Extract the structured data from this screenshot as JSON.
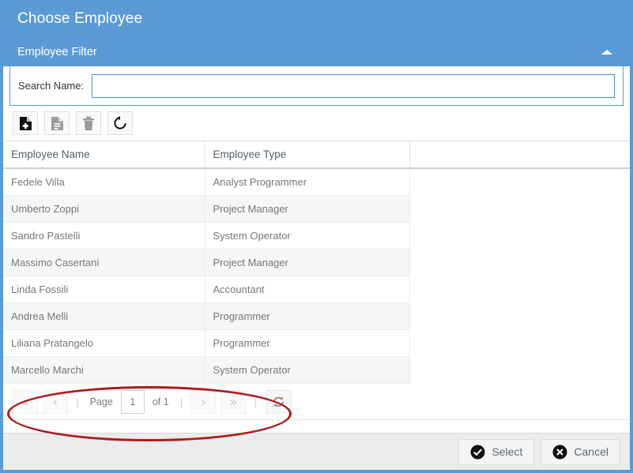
{
  "dialog": {
    "title": "Choose Employee",
    "filter_section_label": "Employee Filter",
    "collapse_icon": "chevron-up-icon"
  },
  "filter": {
    "search_label": "Search Name:",
    "search_value": "",
    "search_placeholder": ""
  },
  "toolbar": {
    "buttons": [
      {
        "name": "new-record-button",
        "icon": "file-plus-icon",
        "enabled": true
      },
      {
        "name": "edit-record-button",
        "icon": "file-lines-icon",
        "enabled": false
      },
      {
        "name": "delete-record-button",
        "icon": "trash-icon",
        "enabled": false
      },
      {
        "name": "reload-button",
        "icon": "refresh-arrow-icon",
        "enabled": true
      }
    ]
  },
  "grid": {
    "columns": [
      "Employee Name",
      "Employee Type",
      ""
    ],
    "rows": [
      {
        "name": "Fedele Villa",
        "type": "Analyst Programmer"
      },
      {
        "name": "Umberto Zoppi",
        "type": "Project Manager"
      },
      {
        "name": "Sandro Pastelli",
        "type": "System Operator"
      },
      {
        "name": "Massimo Casertani",
        "type": "Project Manager"
      },
      {
        "name": "Linda Fossili",
        "type": "Accountant"
      },
      {
        "name": "Andrea Melli",
        "type": "Programmer"
      },
      {
        "name": "Liliana Pratangelo",
        "type": "Programmer"
      },
      {
        "name": "Marcello Marchi",
        "type": "System Operator"
      }
    ]
  },
  "pager": {
    "first_label": "«",
    "prev_label": "‹",
    "separator": "|",
    "page_label": "Page",
    "page_value": "1",
    "of_label": "of 1",
    "next_label": "›",
    "last_label": "»",
    "refresh_icon": "refresh-pager-icon"
  },
  "footer": {
    "select_label": "Select",
    "cancel_label": "Cancel",
    "select_icon": "check-circle-icon",
    "cancel_icon": "x-circle-icon"
  },
  "colors": {
    "header_blue": "#5b9bd5",
    "annotation_red": "#b01b1b",
    "footer_gray": "#ececec",
    "row_alt": "#f6f6f6"
  }
}
